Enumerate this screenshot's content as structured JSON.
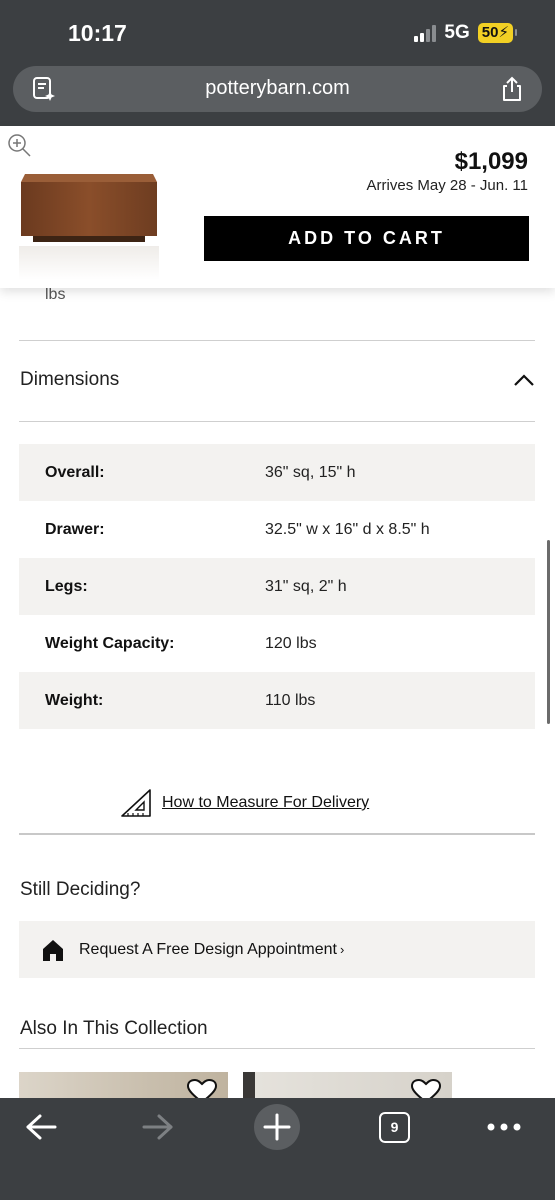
{
  "status_bar": {
    "time": "10:17",
    "network": "5G",
    "battery": "50"
  },
  "browser": {
    "url": "potterybarn.com"
  },
  "product_bar": {
    "price": "$1,099",
    "arrives": "Arrives May 28 - Jun. 11",
    "add_to_cart": "ADD TO CART"
  },
  "partial_text": "lbs",
  "dimensions": {
    "title": "Dimensions",
    "rows": [
      {
        "label": "Overall:",
        "value": "36\" sq, 15\" h"
      },
      {
        "label": "Drawer:",
        "value": "32.5\" w x 16\" d x 8.5\" h"
      },
      {
        "label": "Legs:",
        "value": "31\" sq, 2\" h"
      },
      {
        "label": "Weight Capacity:",
        "value": "120 lbs"
      },
      {
        "label": "Weight:",
        "value": "110 lbs"
      }
    ]
  },
  "measure_link": "How to Measure For Delivery",
  "still_deciding": {
    "title": "Still Deciding?",
    "appointment": "Request A Free Design Appointment",
    "chevron": "›"
  },
  "collection": {
    "title": "Also In This Collection"
  },
  "toolbar": {
    "tab_count": "9"
  },
  "colors": {
    "chrome": "#3c3f42",
    "button": "#000000",
    "row_shade": "#f3f2f0",
    "battery": "#f2d024"
  },
  "icons": [
    "page-icon",
    "share-icon",
    "zoom-icon",
    "chevron-up-icon",
    "ruler-icon",
    "house-icon",
    "heart-icon",
    "back-icon",
    "forward-icon",
    "plus-icon",
    "more-icon"
  ]
}
